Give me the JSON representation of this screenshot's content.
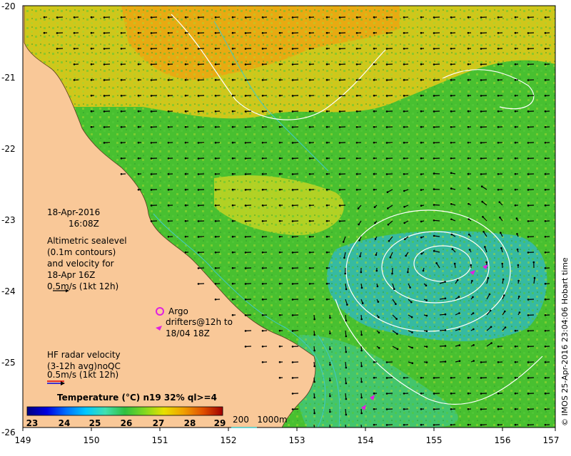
{
  "map": {
    "lon_ticks": [
      "149",
      "150",
      "151",
      "152",
      "153",
      "154",
      "155",
      "156",
      "157"
    ],
    "lat_ticks": [
      "-20",
      "-21",
      "-22",
      "-23",
      "-24",
      "-25",
      "-26"
    ]
  },
  "annotations": {
    "date": "18-Apr-2016",
    "time": "16:08Z",
    "altimetry": [
      "Altimetric sealevel",
      "(0.1m contours)",
      "and velocity for",
      "18-Apr 16Z",
      "0.5m/s (1kt 12h)"
    ],
    "argo": "Argo",
    "drifters": [
      "drifters@12h to",
      "18/04 18Z"
    ],
    "hf_radar": [
      "HF radar velocity",
      "(3-12h avg)noQC",
      "0.5m/s (1kt 12h)"
    ]
  },
  "colorbar": {
    "title": "Temperature (°C) n19 32% ql>=4",
    "ticks": [
      "23",
      "24",
      "25",
      "26",
      "27",
      "28",
      "29"
    ],
    "colors": [
      "#000080",
      "#0000e0",
      "#0070ff",
      "#00c8ff",
      "#40e0b0",
      "#30c040",
      "#80d820",
      "#e8e000",
      "#f0a000",
      "#e05000",
      "#a00000"
    ]
  },
  "bathymetry_legend": "200   1000m",
  "credit": "© IMOS 25-Apr-2016 23:04:06 Hobart time",
  "colors": {
    "land": "#f9c898",
    "contour": "#ffffff",
    "bathymetry": "#40c8c8"
  }
}
